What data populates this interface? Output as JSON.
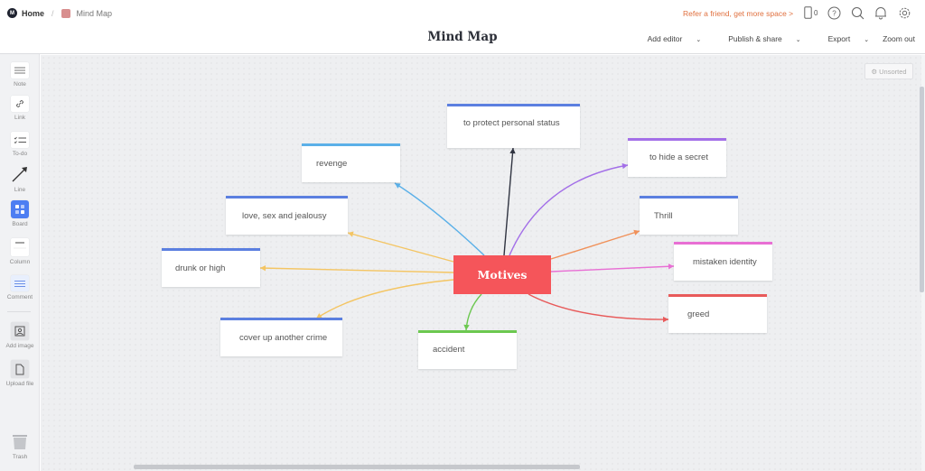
{
  "breadcrumb": {
    "home": "Home",
    "separator": "/",
    "current": "Mind Map"
  },
  "header": {
    "title": "Mind Map",
    "refer_link": "Refer a friend, get more space >",
    "device_count": "0",
    "icons": [
      "phone-icon",
      "help-icon",
      "search-icon",
      "bell-icon",
      "gear-icon"
    ],
    "menu": [
      {
        "label": "Add editor",
        "has_caret": true
      },
      {
        "label": "Publish & share",
        "has_caret": true
      },
      {
        "label": "Export",
        "has_caret": true
      },
      {
        "label": "Zoom out",
        "has_caret": false
      }
    ]
  },
  "sidebar": {
    "tools": [
      {
        "label": "Note",
        "icon": "note-icon"
      },
      {
        "label": "Link",
        "icon": "link-icon"
      },
      {
        "label": "To-do",
        "icon": "todo-icon"
      },
      {
        "label": "Line",
        "icon": "line-arrow-icon"
      },
      {
        "label": "Board",
        "icon": "board-icon"
      },
      {
        "label": "Column",
        "icon": "column-icon"
      },
      {
        "label": "Comment",
        "icon": "comment-icon"
      },
      {
        "label": "Add image",
        "icon": "image-icon"
      },
      {
        "label": "Upload file",
        "icon": "file-icon"
      },
      {
        "label": "Trash",
        "icon": "trash-icon"
      }
    ]
  },
  "canvas": {
    "unsorted_label": "Unsorted",
    "center": {
      "label": "Motives",
      "color": "#f5555a"
    },
    "nodes": [
      {
        "label": "to protect personal status",
        "color": "#5b7fe0",
        "edge": "#2f3340"
      },
      {
        "label": "revenge",
        "color": "#5bb0e8",
        "edge": "#5bb0e8"
      },
      {
        "label": "to hide a secret",
        "color": "#a36fe8",
        "edge": "#a36fe8"
      },
      {
        "label": "love, sex and jealousy",
        "color": "#5b7fe0",
        "edge": "#f4c563"
      },
      {
        "label": "Thrill",
        "color": "#5b7fe0",
        "edge": "#f0915a"
      },
      {
        "label": "drunk or high",
        "color": "#5b7fe0",
        "edge": "#f4c563"
      },
      {
        "label": "mistaken identity",
        "color": "#e86fd4",
        "edge": "#e86fd4"
      },
      {
        "label": "greed",
        "color": "#e85a5a",
        "edge": "#e85a5a"
      },
      {
        "label": "cover up another crime",
        "color": "#5b7fe0",
        "edge": "#f4c563"
      },
      {
        "label": "accident",
        "color": "#6cc850",
        "edge": "#6cc850"
      }
    ]
  }
}
